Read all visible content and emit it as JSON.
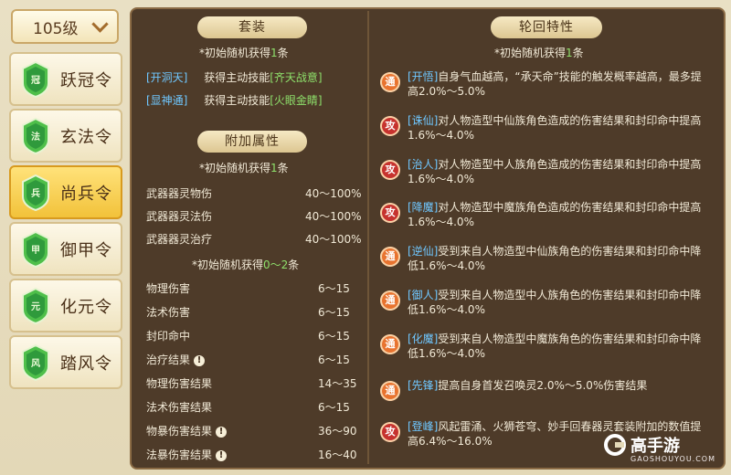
{
  "level_select": {
    "value": "105级"
  },
  "sidebar": {
    "items": [
      {
        "label": "跃冠令",
        "badge": "冠"
      },
      {
        "label": "玄法令",
        "badge": "法"
      },
      {
        "label": "尚兵令",
        "badge": "兵",
        "active": true
      },
      {
        "label": "御甲令",
        "badge": "甲"
      },
      {
        "label": "化元令",
        "badge": "元"
      },
      {
        "label": "踏风令",
        "badge": "风"
      }
    ]
  },
  "left": {
    "set_title": "套装",
    "set_note_prefix": "*初始随机获得",
    "set_note_count": "1",
    "set_note_suffix": "条",
    "skills": [
      {
        "tag": "[开洞天]",
        "text": "获得主动技能",
        "skill": "[齐天战意]"
      },
      {
        "tag": "[显神通]",
        "text": "获得主动技能",
        "skill": "[火眼金睛]"
      }
    ],
    "attr_title": "附加属性",
    "attr_note_prefix": "*初始随机获得",
    "attr_note_count": "1",
    "attr_note_suffix": "条",
    "attrs_a": [
      {
        "name": "武器器灵物伤",
        "value": "40～100%"
      },
      {
        "name": "武器器灵法伤",
        "value": "40～100%"
      },
      {
        "name": "武器器灵治疗",
        "value": "40～100%"
      }
    ],
    "attr_note2_prefix": "*初始随机获得",
    "attr_note2_count": "0～2",
    "attr_note2_suffix": "条",
    "attrs_b": [
      {
        "name": "物理伤害",
        "value": "6～15",
        "warn": false
      },
      {
        "name": "法术伤害",
        "value": "6～15",
        "warn": false
      },
      {
        "name": "封印命中",
        "value": "6～15",
        "warn": false
      },
      {
        "name": "治疗结果",
        "value": "6～15",
        "warn": true
      },
      {
        "name": "物理伤害结果",
        "value": "14～35",
        "warn": false
      },
      {
        "name": "法术伤害结果",
        "value": "6～15",
        "warn": false
      },
      {
        "name": "物暴伤害结果",
        "value": "36～90",
        "warn": true
      },
      {
        "name": "法暴伤害结果",
        "value": "16～40",
        "warn": true
      }
    ]
  },
  "right": {
    "title": "轮回特性",
    "note_prefix": "*初始随机获得",
    "note_count": "1",
    "note_suffix": "条",
    "traits": [
      {
        "icon": "通",
        "kind": "tong",
        "name": "[开悟]",
        "text": "自身气血越高，“承天命”技能的触发概率越高，最多提高2.0%～5.0%"
      },
      {
        "icon": "攻",
        "kind": "gong",
        "name": "[诛仙]",
        "text": "对人物造型中仙族角色造成的伤害结果和封印命中提高1.6%～4.0%"
      },
      {
        "icon": "攻",
        "kind": "gong",
        "name": "[治人]",
        "text": "对人物造型中人族角色造成的伤害结果和封印命中提高1.6%～4.0%"
      },
      {
        "icon": "攻",
        "kind": "gong",
        "name": "[降魔]",
        "text": "对人物造型中魔族角色造成的伤害结果和封印命中提高1.6%～4.0%"
      },
      {
        "icon": "通",
        "kind": "tong",
        "name": "[逆仙]",
        "text": "受到来自人物造型中仙族角色的伤害结果和封印命中降低1.6%～4.0%"
      },
      {
        "icon": "通",
        "kind": "tong",
        "name": "[御人]",
        "text": "受到来自人物造型中人族角色的伤害结果和封印命中降低1.6%～4.0%"
      },
      {
        "icon": "通",
        "kind": "tong",
        "name": "[化魔]",
        "text": "受到来自人物造型中魔族角色的伤害结果和封印命中降低1.6%～4.0%"
      },
      {
        "icon": "通",
        "kind": "tong",
        "name": "[先锋]",
        "text": "提高自身首发召唤灵2.0%～5.0%伤害结果"
      },
      {
        "icon": "攻",
        "kind": "gong",
        "name": "[登峰]",
        "text": "风起雷涌、火狮苍穹、妙手回春器灵套装附加的数值提高6.4%～16.0%"
      }
    ]
  },
  "watermark": {
    "brand": "高手游",
    "site": "GAOSHOUYOU.COM"
  },
  "colors": {
    "accent_blue": "#6fc7ff",
    "accent_green": "#8ee06b",
    "panel_bg": "#4e3b29"
  }
}
